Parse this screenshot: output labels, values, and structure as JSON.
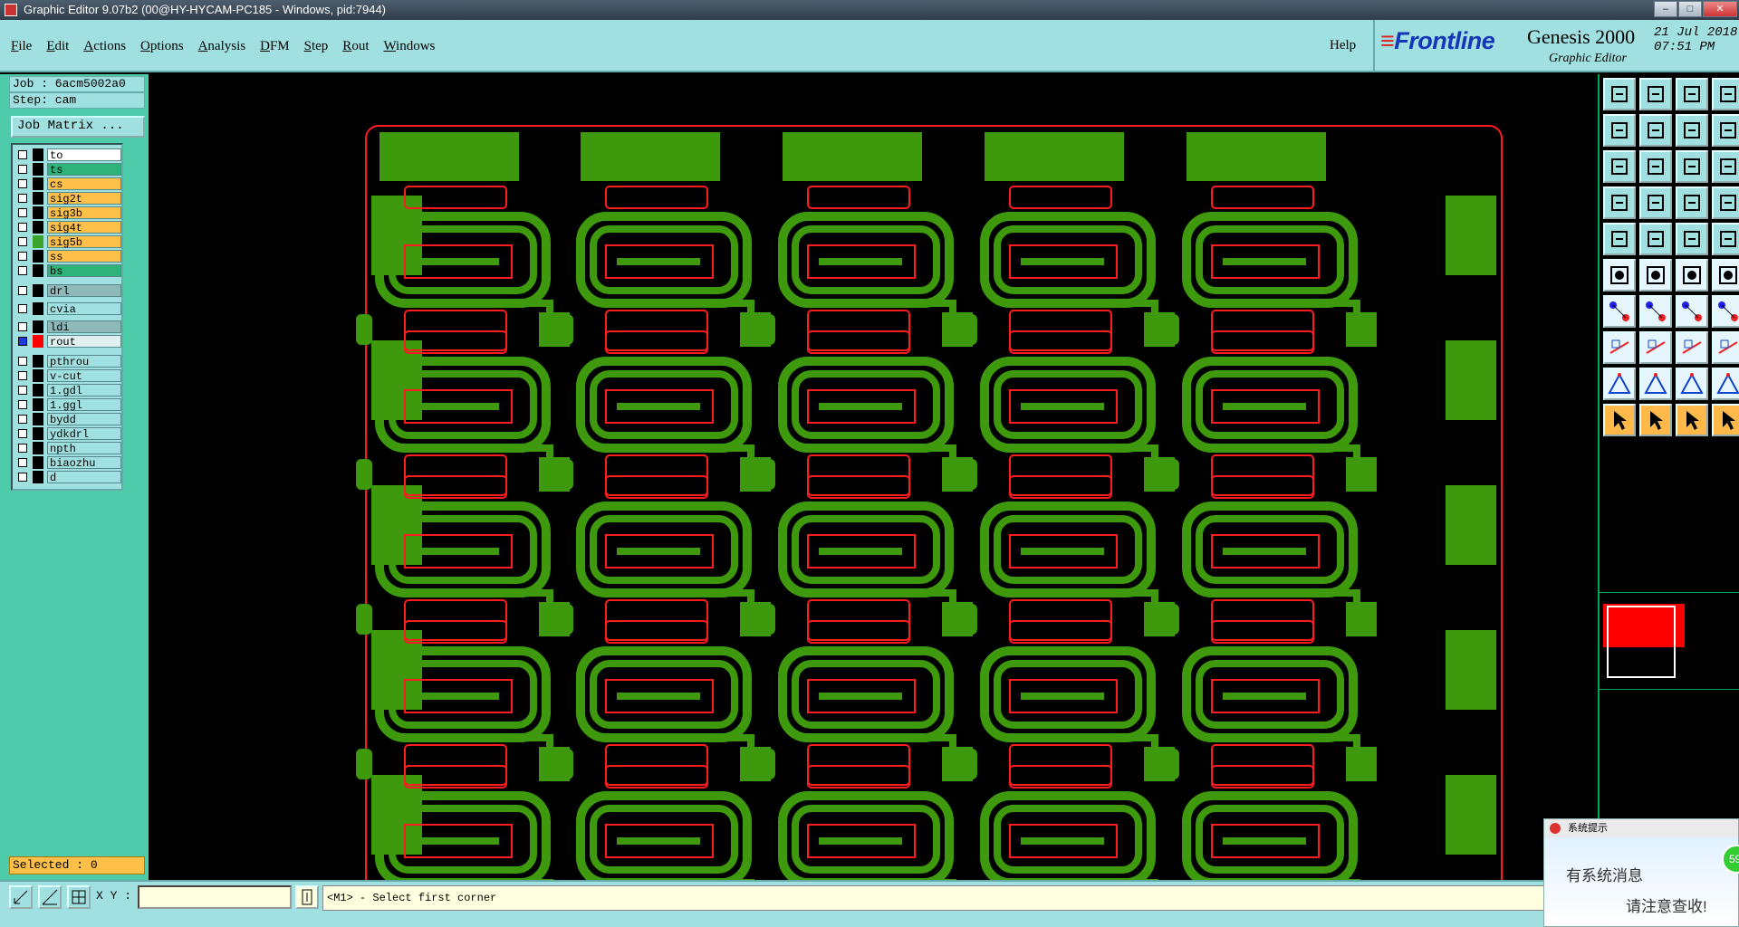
{
  "window": {
    "title": "Graphic Editor 9.07b2 (00@HY-HYCAM-PC185 - Windows, pid:7944)"
  },
  "menu": {
    "items": [
      {
        "u": "F",
        "rest": "ile"
      },
      {
        "u": "E",
        "rest": "dit"
      },
      {
        "u": "A",
        "rest": "ctions"
      },
      {
        "u": "O",
        "rest": "ptions"
      },
      {
        "u": "A",
        "rest": "nalysis"
      },
      {
        "u": "D",
        "rest": "FM"
      },
      {
        "u": "S",
        "rest": "tep"
      },
      {
        "u": "R",
        "rest": "out"
      },
      {
        "u": "W",
        "rest": "indows"
      }
    ],
    "help": "Help"
  },
  "brand": {
    "logo_accent": "≡",
    "logo": "Frontline",
    "product": "Genesis 2000",
    "module": "Graphic Editor",
    "date": "21 Jul 2018",
    "time": "07:51 PM"
  },
  "job": {
    "job_line": "Job : 6acm5002a0",
    "step_line": "Step: cam",
    "matrix_button": "Job Matrix ..."
  },
  "layers": [
    {
      "name": "to",
      "color": "#ffffff",
      "swatch": "#000000"
    },
    {
      "name": "ts",
      "color": "#2fb37a",
      "swatch": "#000000"
    },
    {
      "name": "cs",
      "color": "#ffc04a",
      "swatch": "#000000"
    },
    {
      "name": "sig2t",
      "color": "#ffc04a",
      "swatch": "#000000"
    },
    {
      "name": "sig3b",
      "color": "#ffc04a",
      "swatch": "#000000"
    },
    {
      "name": "sig4t",
      "color": "#ffc04a",
      "swatch": "#000000"
    },
    {
      "name": "sig5b",
      "color": "#ffc04a",
      "swatch": "#3aa52a"
    },
    {
      "name": "ss",
      "color": "#ffc04a",
      "swatch": "#000000"
    },
    {
      "name": "bs",
      "color": "#2fb37a",
      "swatch": "#000000"
    },
    {
      "name": "drl",
      "color": "#8fb8b8",
      "swatch": "#000000"
    },
    {
      "name": "cvia",
      "color": "#a0e0e0",
      "swatch": "#000000"
    },
    {
      "name": "ldi",
      "color": "#8fb8b8",
      "swatch": "#000000"
    },
    {
      "name": "rout",
      "color": "#e0f0f0",
      "swatch": "#ff0000"
    },
    {
      "name": "pthrou",
      "color": "#a0e0e0",
      "swatch": "#000000"
    },
    {
      "name": "v-cut",
      "color": "#a0e0e0",
      "swatch": "#000000"
    },
    {
      "name": "1.gdl",
      "color": "#a0e0e0",
      "swatch": "#000000"
    },
    {
      "name": "1.ggl",
      "color": "#a0e0e0",
      "swatch": "#000000"
    },
    {
      "name": "bydd",
      "color": "#a0e0e0",
      "swatch": "#000000"
    },
    {
      "name": "ydkdrl",
      "color": "#a0e0e0",
      "swatch": "#000000"
    },
    {
      "name": "npth",
      "color": "#a0e0e0",
      "swatch": "#000000"
    },
    {
      "name": "biaozhu",
      "color": "#a0e0e0",
      "swatch": "#000000"
    },
    {
      "name": "d",
      "color": "#a0e0e0",
      "swatch": "#000000"
    }
  ],
  "status": {
    "selected": "Selected : 0",
    "xy_label": "X Y :",
    "xy_value": "",
    "prompt": "<M1> - Select first corner"
  },
  "popup": {
    "title": "系统提示",
    "line1": "有系统消息",
    "line2": "请注意查收!",
    "badge": "59"
  },
  "board": {
    "copper_color": "#3e9a0c",
    "rout_color": "#ff1c1c",
    "columns": 5,
    "rows": 5
  }
}
